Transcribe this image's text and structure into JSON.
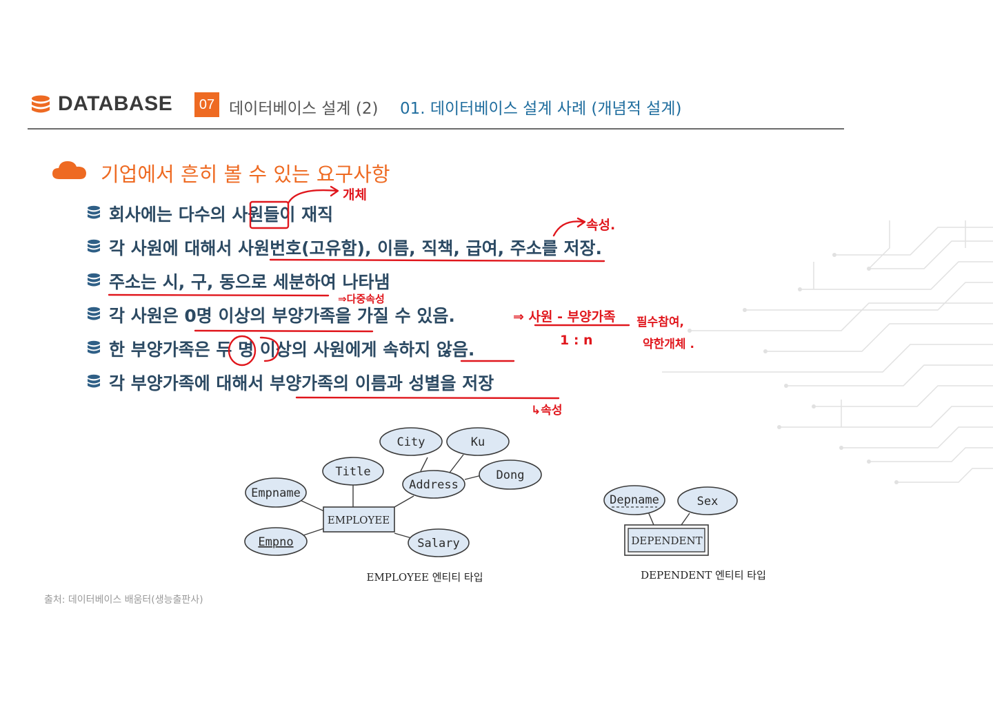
{
  "header": {
    "brand": "DATABASE",
    "chapter_number": "07",
    "chapter_title": "데이터베이스 설계 (2)",
    "section_title": "01. 데이터베이스 설계 사례 (개념적 설계)"
  },
  "heading": "기업에서 흔히 볼 수 있는 요구사항",
  "requirements": [
    "회사에는 다수의 사원들이 재직",
    "각 사원에 대해서 사원번호(고유함), 이름, 직책, 급여, 주소를 저장.",
    "주소는 시, 구, 동으로 세분하여 나타냄",
    "각 사원은 0명 이상의 부양가족을 가질 수 있음.",
    "한 부양가족은 두 명 이상의 사원에게 속하지 않음.",
    "각 부양가족에 대해서 부양가족의 이름과 성별을 저장"
  ],
  "handwritten_notes": {
    "entity": "개체",
    "attribute": "속성.",
    "multivalued": "⇒다중속성",
    "relation": "⇒ 사원 - 부양가족",
    "cardinality": "1 : n",
    "weak_entity_line1": "필수참여,",
    "weak_entity_line2": "약한개체 .",
    "attribute_arrow": "↳속성"
  },
  "er_diagram": {
    "employee": {
      "entity": "EMPLOYEE",
      "attributes": [
        "Empname",
        "Empno",
        "Title",
        "Address",
        "City",
        "Ku",
        "Dong",
        "Salary"
      ],
      "caption": "EMPLOYEE 엔티티 타입"
    },
    "dependent": {
      "entity": "DEPENDENT",
      "attributes": [
        "Depname",
        "Sex"
      ],
      "caption": "DEPENDENT 엔티티 타입"
    }
  },
  "source": "출처: 데이터베이스 배움터(생능출판사)",
  "colors": {
    "accent_orange": "#ee6a22",
    "title_blue": "#1f6d9e",
    "text_navy": "#2c4a63",
    "annotation_red": "#e0161c"
  }
}
